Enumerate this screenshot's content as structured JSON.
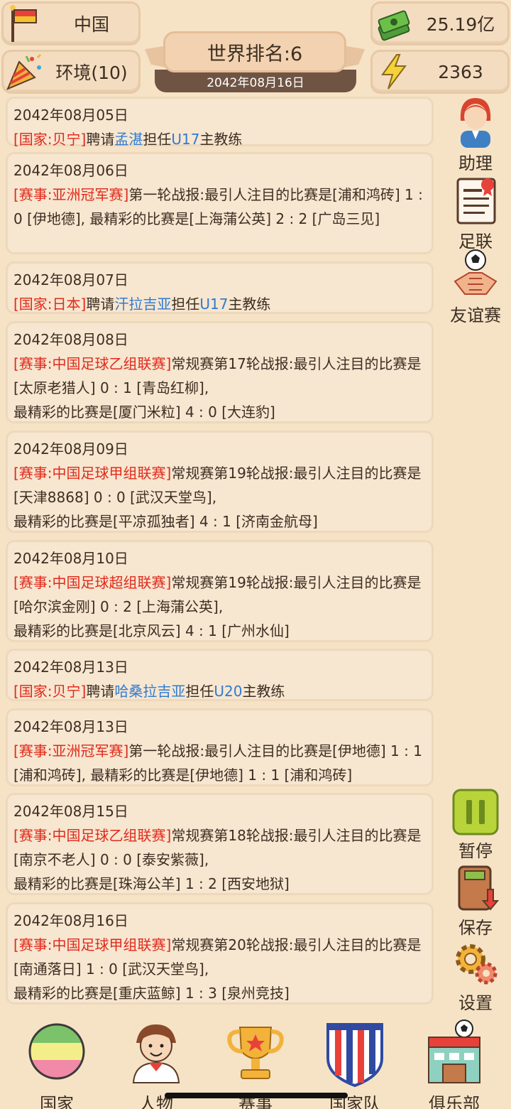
{
  "topbar": {
    "country": "中国",
    "environment": "环境(10)",
    "rank": "世界排名:6",
    "date": "2042年08月16日",
    "money": "25.19亿",
    "energy": "2363"
  },
  "icons": {
    "country": "flag-icon",
    "environment": "party-popper-icon",
    "money": "money-stack-icon",
    "energy": "lightning-icon"
  },
  "news": [
    {
      "date": "2042年08月05日",
      "parts": [
        {
          "t": "[国家:贝宁]",
          "c": "red"
        },
        {
          "t": "聘请"
        },
        {
          "t": "孟湛",
          "c": "blue"
        },
        {
          "t": "担任"
        },
        {
          "t": "U17",
          "c": "blue"
        },
        {
          "t": "主教练"
        }
      ]
    },
    {
      "date": "2042年08月06日",
      "parts": [
        {
          "t": "[赛事:亚洲冠军赛]",
          "c": "red"
        },
        {
          "t": "第一轮战报:最引人注目的比赛是[浦和鸿砖] 1 : 0 [伊地德], 最精彩的比赛是[上海蒲公英] 2 : 2 [广岛三见]"
        }
      ]
    },
    {
      "date": "2042年08月07日",
      "parts": [
        {
          "t": "[国家:日本]",
          "c": "red"
        },
        {
          "t": "聘请"
        },
        {
          "t": "汗拉吉亚",
          "c": "blue"
        },
        {
          "t": "担任"
        },
        {
          "t": "U17",
          "c": "blue"
        },
        {
          "t": "主教练"
        }
      ]
    },
    {
      "date": "2042年08月08日",
      "parts": [
        {
          "t": "[赛事:中国足球乙组联赛]",
          "c": "red"
        },
        {
          "t": "常规赛第17轮战报:最引人注目的比赛是[太原老猎人] 0 : 1 [青岛红柳],"
        },
        {
          "t": "最精彩的比赛是[厦门米粒] 4 : 0 [大连豹]",
          "br": true
        }
      ]
    },
    {
      "date": "2042年08月09日",
      "parts": [
        {
          "t": "[赛事:中国足球甲组联赛]",
          "c": "red"
        },
        {
          "t": "常规赛第19轮战报:最引人注目的比赛是[天津8868] 0 : 0 [武汉天堂鸟],"
        },
        {
          "t": "最精彩的比赛是[平凉孤独者] 4 : 1 [济南金航母]",
          "br": true
        }
      ]
    },
    {
      "date": "2042年08月10日",
      "parts": [
        {
          "t": "[赛事:中国足球超组联赛]",
          "c": "red"
        },
        {
          "t": "常规赛第19轮战报:最引人注目的比赛是[哈尔滨金刚] 0 : 2 [上海蒲公英],"
        },
        {
          "t": "最精彩的比赛是[北京风云] 4 : 1 [广州水仙]",
          "br": true
        }
      ]
    },
    {
      "date": "2042年08月13日",
      "parts": [
        {
          "t": "[国家:贝宁]",
          "c": "red"
        },
        {
          "t": "聘请"
        },
        {
          "t": "哈桑拉吉亚",
          "c": "blue"
        },
        {
          "t": "担任"
        },
        {
          "t": "U20",
          "c": "blue"
        },
        {
          "t": "主教练"
        }
      ]
    },
    {
      "date": "2042年08月13日",
      "parts": [
        {
          "t": "[赛事:亚洲冠军赛]",
          "c": "red"
        },
        {
          "t": "第一轮战报:最引人注目的比赛是[伊地德] 1 : 1 [浦和鸿砖], 最精彩的比赛是[伊地德] 1 : 1 [浦和鸿砖]"
        }
      ]
    },
    {
      "date": "2042年08月15日",
      "parts": [
        {
          "t": "[赛事:中国足球乙组联赛]",
          "c": "red"
        },
        {
          "t": "常规赛第18轮战报:最引人注目的比赛是[南京不老人] 0 : 0 [泰安紫薇],"
        },
        {
          "t": "最精彩的比赛是[珠海公羊] 1 : 2 [西安地狱]",
          "br": true
        }
      ]
    },
    {
      "date": "2042年08月16日",
      "parts": [
        {
          "t": "[赛事:中国足球甲组联赛]",
          "c": "red"
        },
        {
          "t": "常规赛第20轮战报:最引人注目的比赛是[南通落日] 1 : 0 [武汉天堂鸟],"
        },
        {
          "t": "最精彩的比赛是[重庆蓝鲸] 1 : 3 [泉州竞技]",
          "br": true
        }
      ]
    }
  ],
  "side": {
    "assistant": "助理",
    "federation": "足联",
    "friendly": "友谊赛",
    "pause": "暂停",
    "save": "保存",
    "settings": "设置"
  },
  "nav": {
    "country": "国家",
    "people": "人物",
    "events": "赛事",
    "national_team": "国家队",
    "club": "俱乐部"
  },
  "colors": {
    "background": "#f6e3c6",
    "event_red": "#e02a1b",
    "name_blue": "#2f7bd0",
    "pause_green": "#b8d43a"
  }
}
